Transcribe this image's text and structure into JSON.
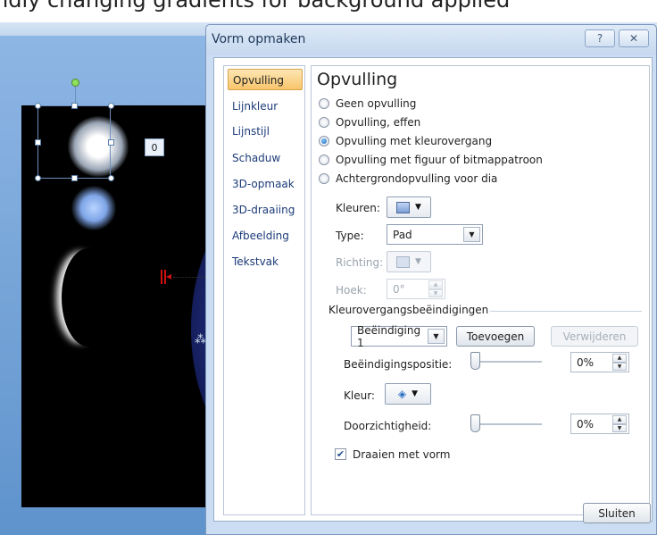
{
  "background": {
    "header_text": "ndly changing gradients for background applied",
    "selection_label": "0"
  },
  "dialog": {
    "title": "Vorm opmaken",
    "help_glyph": "?",
    "close_glyph": "✕",
    "nav": [
      {
        "label": "Opvulling",
        "active": true
      },
      {
        "label": "Lijnkleur",
        "active": false
      },
      {
        "label": "Lijnstijl",
        "active": false
      },
      {
        "label": "Schaduw",
        "active": false
      },
      {
        "label": "3D-opmaak",
        "active": false
      },
      {
        "label": "3D-draaiing",
        "active": false
      },
      {
        "label": "Afbeelding",
        "active": false
      },
      {
        "label": "Tekstvak",
        "active": false
      }
    ],
    "panel": {
      "title": "Opvulling",
      "fill_options": [
        {
          "label": "Geen opvulling",
          "checked": false
        },
        {
          "label": "Opvulling, effen",
          "checked": false
        },
        {
          "label": "Opvulling met kleurovergang",
          "checked": true
        },
        {
          "label": "Opvulling met figuur of bitmappatroon",
          "checked": false
        },
        {
          "label": "Achtergrondopvulling voor dia",
          "checked": false
        }
      ],
      "colors_label": "Kleuren:",
      "type_label": "Type:",
      "type_value": "Pad",
      "direction_label": "Richting:",
      "angle_label": "Hoek:",
      "angle_value": "0°",
      "gradient_stops_heading": "Kleurovergangsbeëindigingen",
      "stop_select_value": "Beëindiging 1",
      "add_button": "Toevoegen",
      "remove_button": "Verwijderen",
      "stop_position_label": "Beëindigingspositie:",
      "stop_position_value": "0%",
      "color_label": "Kleur:",
      "transparency_label": "Doorzichtigheid:",
      "transparency_value": "0%",
      "rotate_with_shape_label": "Draaien met vorm",
      "rotate_with_shape_checked": true
    },
    "close_button": "Sluiten"
  }
}
